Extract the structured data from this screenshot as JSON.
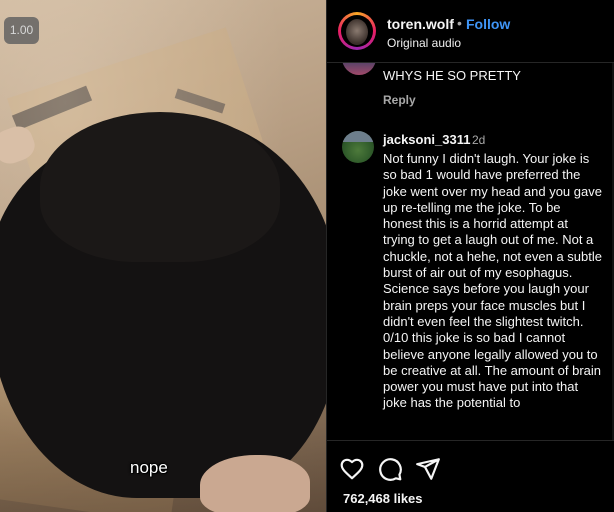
{
  "video": {
    "speed_badge": "1.00",
    "caption": "nope"
  },
  "header": {
    "username": "toren.wolf",
    "separator": "•",
    "follow_label": "Follow",
    "audio_label": "Original audio"
  },
  "comments": {
    "previous": {
      "text": "WHYS HE SO PRETTY",
      "reply_label": "Reply"
    },
    "main": {
      "username": "jacksoni_3311",
      "time": "2d",
      "text": "Not funny I didn't laugh. Your joke is so bad 1 would have preferred the joke went over my head and you gave up re-telling me the joke. To be honest this is a horrid attempt at trying to get a laugh out of me. Not a chuckle, not a hehe, not even a subtle burst of air out of my esophagus. Science says before you laugh your brain preps your face muscles but I didn't even feel the slightest twitch.\n0/10 this joke is so bad I cannot believe anyone legally allowed you to be creative at all. The amount of brain power you must have put into that joke has the potential to"
    }
  },
  "footer": {
    "likes": "762,468 likes"
  },
  "icons": [
    "heart-icon",
    "comment-icon",
    "share-icon"
  ],
  "colors": {
    "background": "#000000",
    "accent_follow": "#3f95f6",
    "secondary_text": "#a8a8a8"
  }
}
